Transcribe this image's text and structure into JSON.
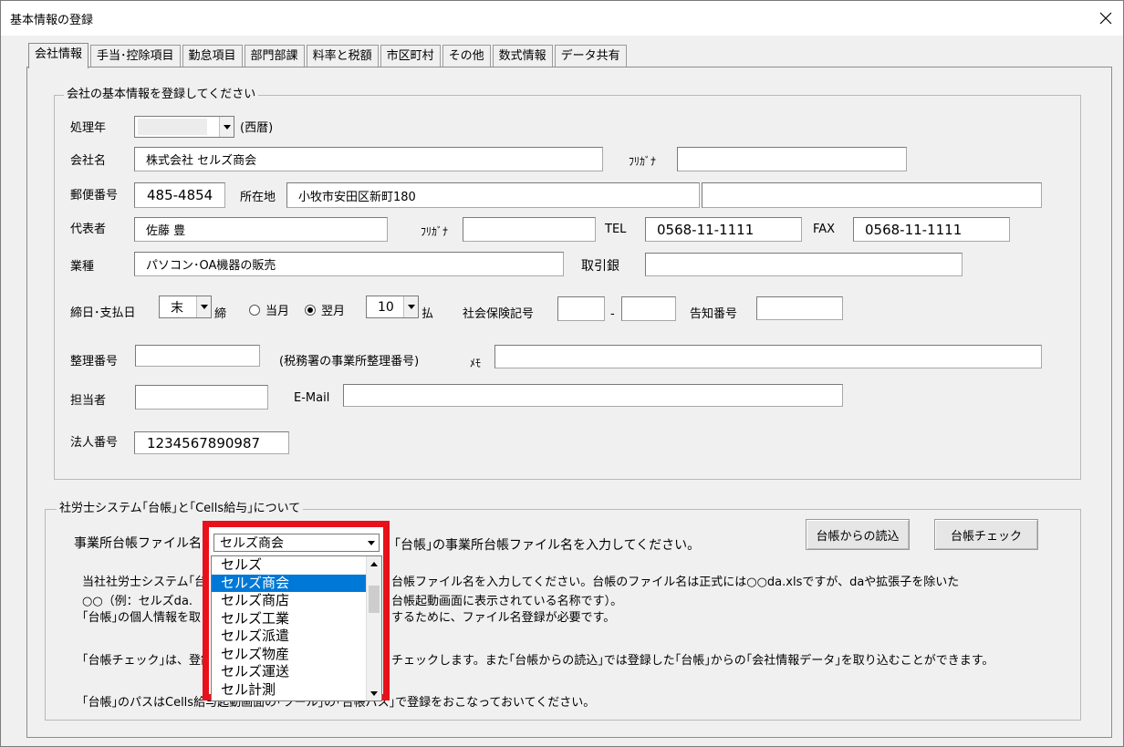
{
  "window": {
    "title": "基本情報の登録"
  },
  "tabs": [
    "会社情報",
    "手当･控除項目",
    "勤怠項目",
    "部門部課",
    "料率と税額",
    "市区町村",
    "その他",
    "数式情報",
    "データ共有"
  ],
  "company": {
    "legend": "会社の基本情報を登録してください",
    "year": {
      "label": "処理年",
      "value": "",
      "note": "(西暦)"
    },
    "name": {
      "label": "会社名",
      "value": "株式会社 セルズ商会",
      "kana_label": "ﾌﾘｶﾞﾅ",
      "kana_value": ""
    },
    "postal": {
      "label": "郵便番号",
      "value": "485-4854"
    },
    "address": {
      "label": "所在地",
      "value1": "小牧市安田区新町180",
      "value2": ""
    },
    "rep": {
      "label": "代表者",
      "value": "佐藤 豊",
      "kana_label": "ﾌﾘｶﾞﾅ",
      "kana_value": ""
    },
    "tel": {
      "label": "TEL",
      "value": "0568-11-1111"
    },
    "fax": {
      "label": "FAX",
      "value": "0568-11-1111"
    },
    "industry": {
      "label": "業種",
      "value": "パソコン･OA機器の販売"
    },
    "bank": {
      "label": "取引銀",
      "value": ""
    },
    "closing": {
      "label": "締日･支払日",
      "close_day": "末",
      "close_suffix": "締",
      "radio_current": "当月",
      "radio_next": "翌月",
      "pay_day": "10",
      "pay_suffix": "払"
    },
    "social": {
      "label": "社会保険記号",
      "value1": "",
      "dash": "-",
      "value2": ""
    },
    "notice": {
      "label": "告知番号",
      "value": ""
    },
    "ref": {
      "label": "整理番号",
      "value": "",
      "note": "(税務署の事業所整理番号)"
    },
    "memo": {
      "label": "ﾒﾓ",
      "value": ""
    },
    "staff": {
      "label": "担当者",
      "value": ""
    },
    "email": {
      "label": "E-Mail",
      "value": ""
    },
    "corp_no": {
      "label": "法人番号",
      "value": "1234567890987"
    }
  },
  "ledger": {
    "legend": "社労士システム｢台帳｣と｢Cells給与｣について",
    "file_label": "事業所台帳ファイル名",
    "file_value": "セルズ商会",
    "hint": "｢台帳｣の事業所台帳ファイル名を入力してください。",
    "read_button": "台帳からの読込",
    "check_button": "台帳チェック",
    "para1_line1_a": "当社社労士システム｢台",
    "para1_line1_b": "台帳ファイル名を入力してください。台帳のファイル名は正式には○○da.xlsですが、daや拡張子を除いた",
    "para1_line2_a": "○○（例：セルズda.",
    "para1_line2_b": "台帳起動画面に表示されている名称です）。",
    "para1_line3_a": "｢台帳｣の個人情報を取",
    "para1_line3_b": "するために、ファイル名登録が必要です。",
    "para2_a": "｢台帳チェック｣は、登録し",
    "para2_b": "チェックします。また｢台帳からの読込｣では登録した｢台帳｣からの｢会社情報データ｣を取り込むことができます。",
    "para3": "｢台帳｣のパスはCells給与起動画面の｢ツール｣の｢台帳パス｣で登録をおこなっておいてください。",
    "dropdown_options": [
      "セルズ",
      "セルズ商会",
      "セルズ商店",
      "セルズ工業",
      "セルズ派遣",
      "セルズ物産",
      "セルズ運送",
      "セル計測"
    ],
    "dropdown_selected": "セルズ商会"
  },
  "colors": {
    "highlight_border": "#e8101a",
    "selection": "#0078d7"
  }
}
